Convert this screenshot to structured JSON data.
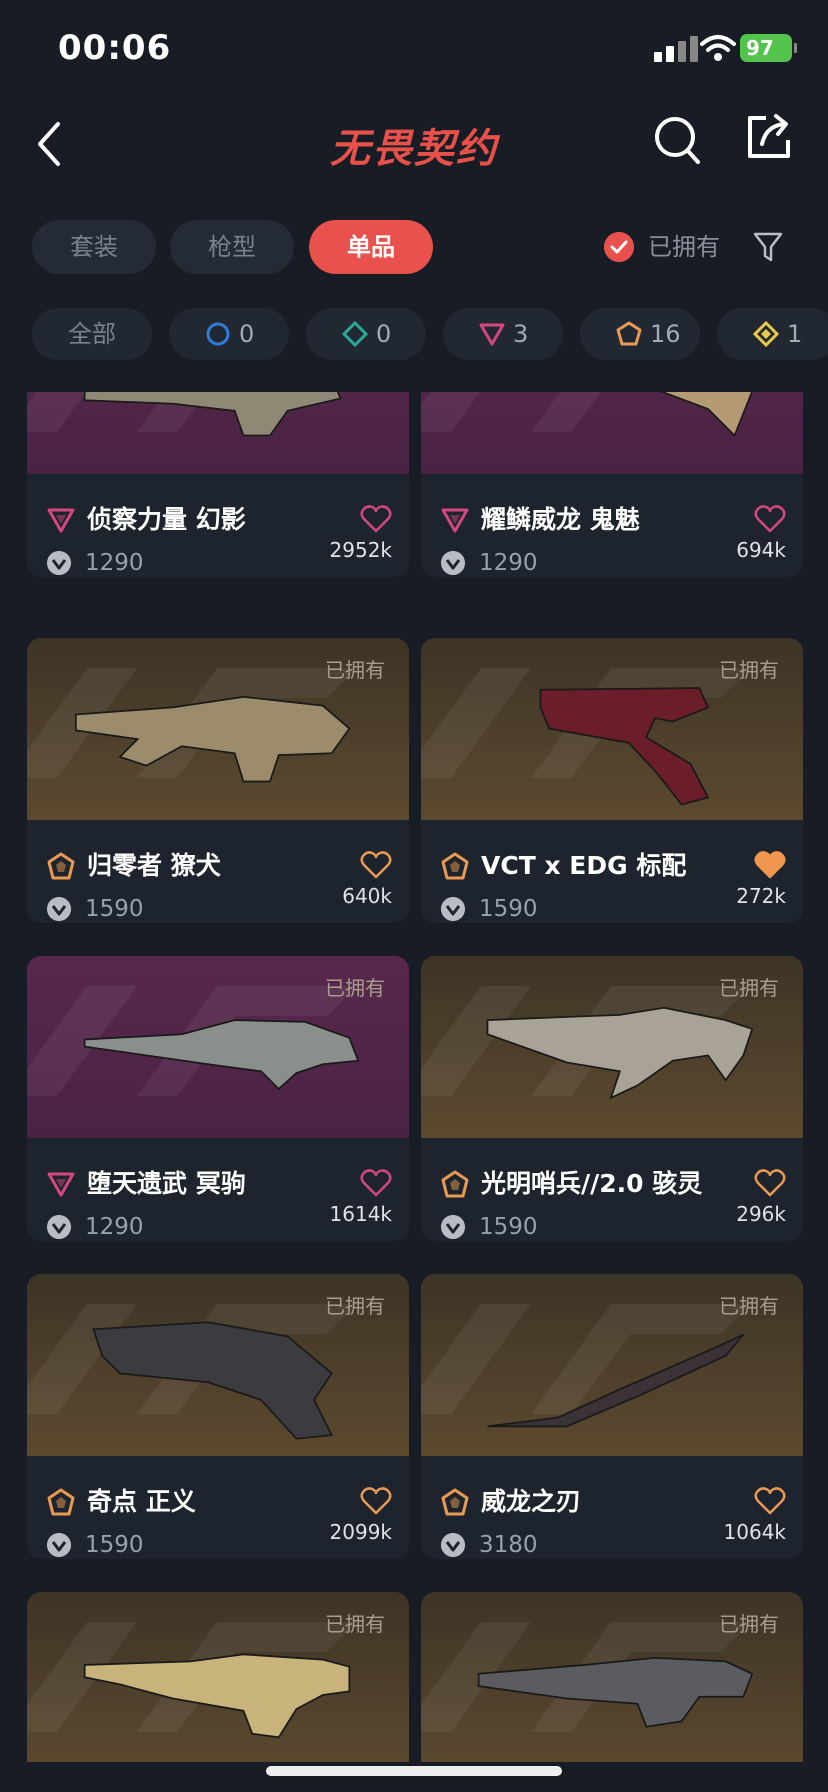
{
  "status": {
    "time": "00:06",
    "battery": "97"
  },
  "header": {
    "title": "无畏契约"
  },
  "tabs": [
    {
      "label": "套装",
      "active": false
    },
    {
      "label": "枪型",
      "active": false
    },
    {
      "label": "单品",
      "active": true
    }
  ],
  "owned_filter": {
    "label": "已拥有",
    "checked": true
  },
  "rarity_filters": [
    {
      "label": "全部"
    },
    {
      "count": "0",
      "color": "#2f7bd6"
    },
    {
      "count": "0",
      "color": "#2aa89a"
    },
    {
      "count": "3",
      "color": "#d2477f"
    },
    {
      "count": "16",
      "color": "#e89a52"
    },
    {
      "count": "1",
      "color": "#e9c94a"
    }
  ],
  "items": [
    {
      "name": "侦察力量 幻影",
      "price": "1290",
      "likes": "2952k",
      "owned": false,
      "owned_label": "",
      "rarity": "premium",
      "bg": "purple",
      "liked": false
    },
    {
      "name": "耀鳞威龙 鬼魅",
      "price": "1290",
      "likes": "694k",
      "owned": false,
      "owned_label": "",
      "rarity": "premium",
      "bg": "purple",
      "liked": false
    },
    {
      "name": "归零者 獠犬",
      "price": "1590",
      "likes": "640k",
      "owned": true,
      "owned_label": "已拥有",
      "rarity": "exclusive",
      "bg": "gold",
      "liked": false
    },
    {
      "name": "VCT x EDG 标配",
      "price": "1590",
      "likes": "272k",
      "owned": true,
      "owned_label": "已拥有",
      "rarity": "exclusive",
      "bg": "gold",
      "liked": true
    },
    {
      "name": "堕天遗武 冥驹",
      "price": "1290",
      "likes": "1614k",
      "owned": true,
      "owned_label": "已拥有",
      "rarity": "premium",
      "bg": "purple",
      "liked": false
    },
    {
      "name": "光明哨兵//2.0 骇灵",
      "price": "1590",
      "likes": "296k",
      "owned": true,
      "owned_label": "已拥有",
      "rarity": "exclusive",
      "bg": "gold",
      "liked": false
    },
    {
      "name": "奇点 正义",
      "price": "1590",
      "likes": "2099k",
      "owned": true,
      "owned_label": "已拥有",
      "rarity": "exclusive",
      "bg": "gold",
      "liked": false
    },
    {
      "name": "威龙之刃",
      "price": "3180",
      "likes": "1064k",
      "owned": true,
      "owned_label": "已拥有",
      "rarity": "exclusive",
      "bg": "gold",
      "liked": false
    },
    {
      "name": "",
      "price": "",
      "likes": "",
      "owned": true,
      "owned_label": "已拥有",
      "rarity": "exclusive",
      "bg": "gold",
      "liked": false
    },
    {
      "name": "",
      "price": "",
      "likes": "",
      "owned": true,
      "owned_label": "已拥有",
      "rarity": "exclusive",
      "bg": "gold",
      "liked": false
    }
  ],
  "colors": {
    "accent": "#e9524c",
    "premium": "#d2477f",
    "exclusive": "#e89a52",
    "liked": "#f0964f"
  }
}
